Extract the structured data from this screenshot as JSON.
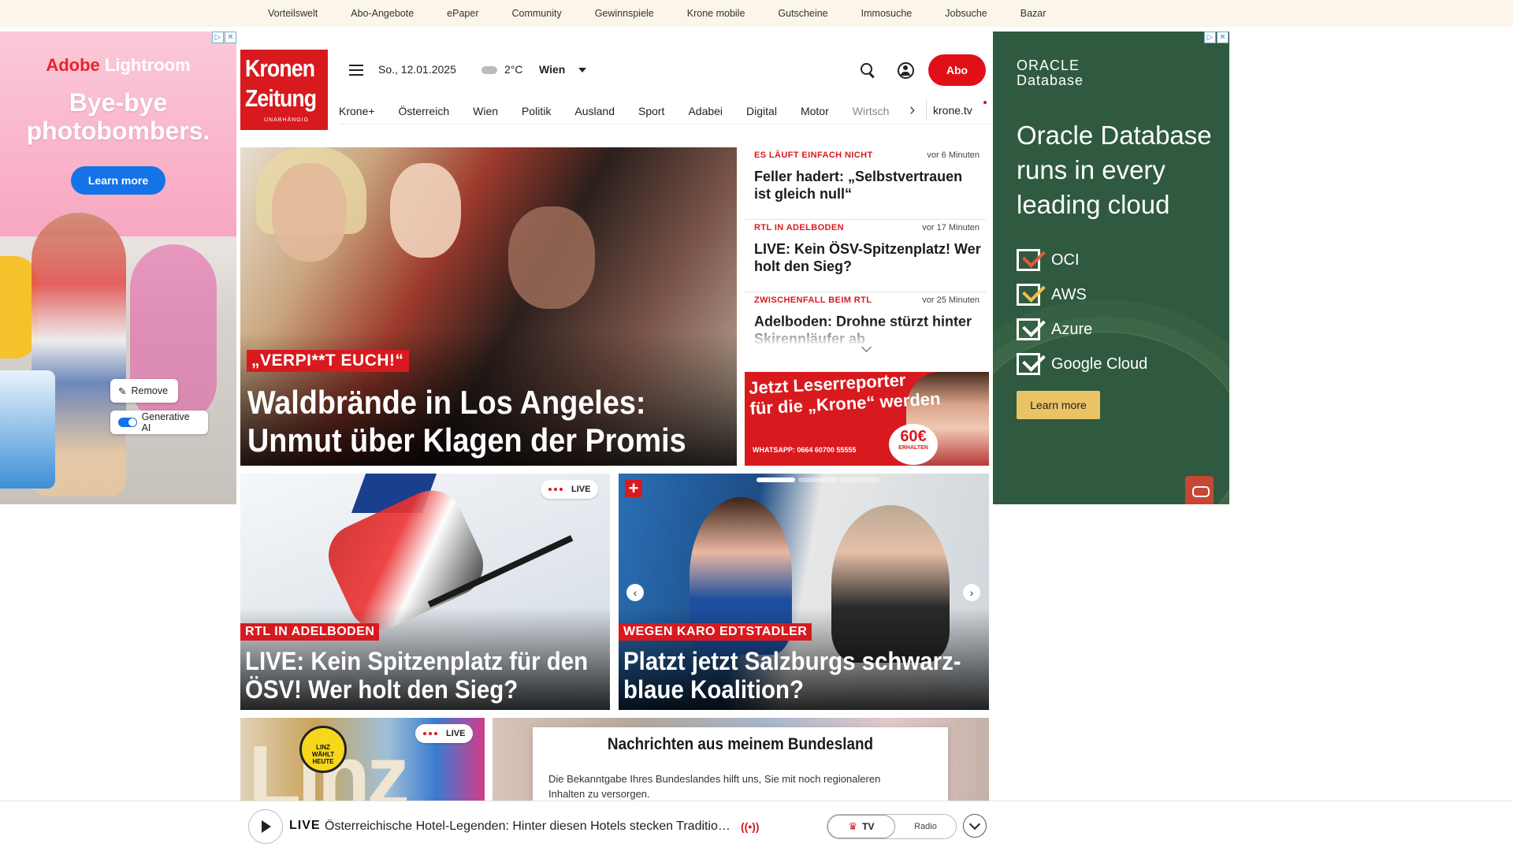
{
  "topbar": {
    "items": [
      "Vorteilswelt",
      "Abo-Angebote",
      "ePaper",
      "Community",
      "Gewinnspiele",
      "Krone mobile",
      "Gutscheine",
      "Immosuche",
      "Jobsuche",
      "Bazar"
    ]
  },
  "ad_left": {
    "brand_a": "Adobe",
    "brand_b": " Lightroom",
    "headline_1": "Bye-bye",
    "headline_2": "photobombers.",
    "cta": "Learn more",
    "remove_label": "Remove",
    "genai_label": "Generative AI",
    "adchoices": "▷",
    "close": "✕"
  },
  "ad_right": {
    "logo_1": "ORACLE",
    "logo_2": "Database",
    "title": "Oracle Database runs in every leading cloud",
    "list": [
      "OCI",
      "AWS",
      "Azure",
      "Google Cloud"
    ],
    "cta": "Learn more",
    "adchoices": "▷",
    "close": "✕"
  },
  "header": {
    "logo_line1": "Kronen",
    "logo_line2": "Zeitung",
    "logo_tagline": "UNABHÄNGIG",
    "date": "So., 12.01.2025",
    "temperature": "2°C",
    "city": "Wien",
    "abo_label": "Abo"
  },
  "nav": {
    "items": [
      "Krone+",
      "Österreich",
      "Wien",
      "Politik",
      "Ausland",
      "Sport",
      "Adabei",
      "Digital",
      "Motor"
    ],
    "faded_item": "Wirtsch",
    "arrow": "›",
    "tv": "krone.tv"
  },
  "hero": {
    "kicker": "„VERPI**T EUCH!“",
    "title": "Waldbrände in Los Angeles: Unmut über Klagen der Promis"
  },
  "news": [
    {
      "kicker": "ES LÄUFT EINFACH NICHT",
      "time": "vor 6 Minuten",
      "headline": "Feller hadert: „Selbstvertrauen ist gleich null“"
    },
    {
      "kicker": "RTL IN ADELBODEN",
      "time": "vor 17 Minuten",
      "headline": "LIVE: Kein ÖSV-Spitzenplatz! Wer holt den Sieg?"
    },
    {
      "kicker": "ZWISCHENFALL BEIM RTL",
      "time": "vor 25 Minuten",
      "headline": "Adelboden: Drohne stürzt hinter Skirennläufer ab"
    }
  ],
  "reporter_banner": {
    "line1": "Jetzt Leserreporter",
    "line2": "für die „Krone“ werden",
    "whatsapp": "WHATSAPP: 0664 60700 55555",
    "price": "60€",
    "price_sub": "ERHALTEN"
  },
  "cards": [
    {
      "live": "LIVE",
      "kicker": "RTL IN ADELBODEN",
      "title": "LIVE: Kein Spitzenplatz für den ÖSV! Wer holt den Sieg?"
    },
    {
      "plus": "+",
      "kicker": "WEGEN KARO EDTSTADLER",
      "title": "Platzt jetzt Salzburgs schwarz-blaue Koalition?",
      "prev": "‹",
      "next": "›"
    }
  ],
  "third_row": {
    "linz_big": "Linz",
    "linz_badge_1": "LINZ",
    "linz_badge_2": "WÄHLT",
    "linz_badge_3": "HEUTE",
    "live": "LIVE"
  },
  "bundesland": {
    "heading": "Nachrichten aus meinem Bundesland",
    "text": "Die Bekanntgabe Ihres Bundeslandes hilft uns, Sie mit noch regionaleren Inhalten zu versorgen."
  },
  "player": {
    "live_label": "LIVE",
    "description": "Österreichische Hotel-Legenden: Hinter diesen Hotels stecken Traditions...",
    "wave": "((•))",
    "tv_label": "TV",
    "crown": "♛",
    "radio_label": "Radio"
  }
}
